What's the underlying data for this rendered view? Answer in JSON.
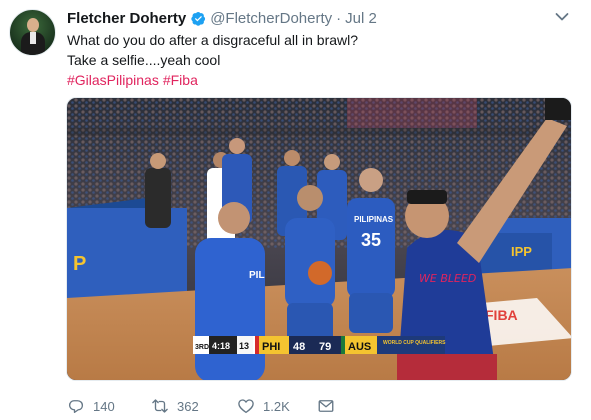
{
  "tweet": {
    "author": {
      "display_name": "Fletcher Doherty",
      "handle": "@FletcherDoherty",
      "verified": true
    },
    "separator": "·",
    "date": "Jul 2",
    "text_lines": [
      "What do you do after a disgraceful all in brawl?",
      "Take a selfie....yeah cool"
    ],
    "hashtags": [
      "#GilasPilipinas",
      "#Fiba"
    ],
    "media": {
      "scoreboard": {
        "period": "3RD",
        "clock": "4:18",
        "shot_clock": "13",
        "home_team": "PHI",
        "home_score": "48",
        "away_score": "79",
        "away_team": "AUS",
        "event": "WORLD CUP QUALIFIERS"
      },
      "jersey_number_left": "35",
      "jersey_number_mid": "35",
      "jersey_team_text": "PILIPINAS",
      "banner_text": "FIBA"
    },
    "actions": {
      "reply_count": "140",
      "retweet_count": "362",
      "like_count": "1.2K"
    },
    "colors": {
      "hashtag": "#e0245e",
      "verified": "#1da1f2",
      "muted": "#657786"
    }
  }
}
